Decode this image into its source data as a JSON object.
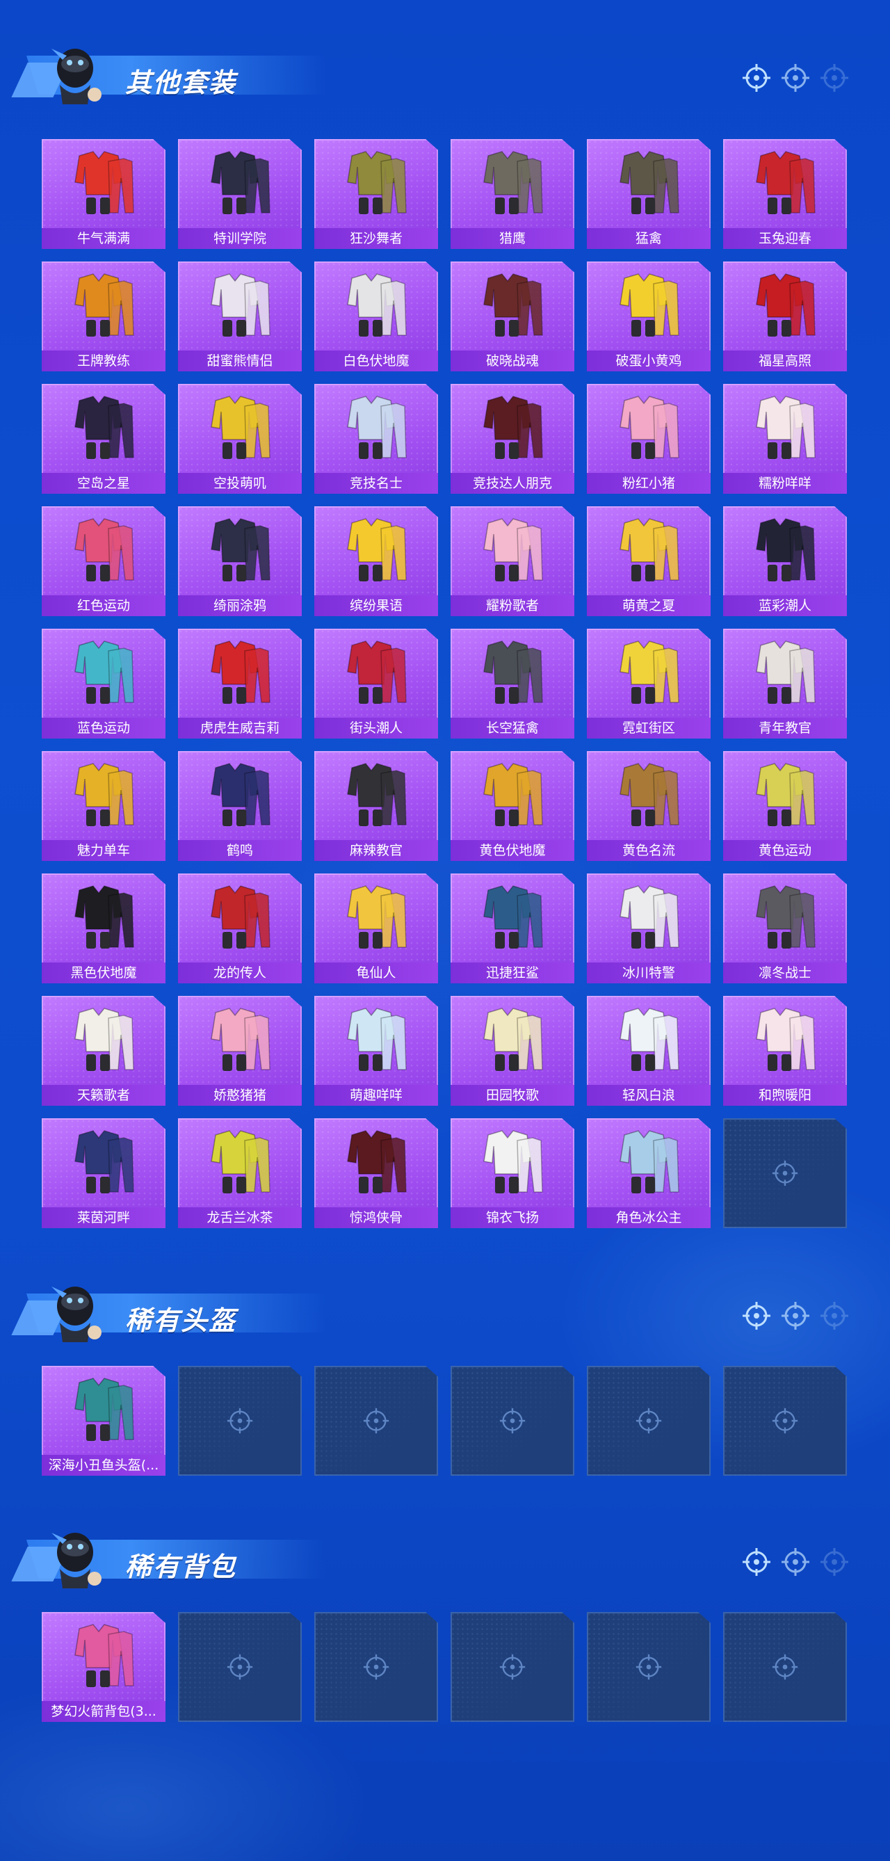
{
  "sections": [
    {
      "title": "其他套装",
      "items": [
        {
          "label": "牛气满满",
          "art": "#e0342b"
        },
        {
          "label": "特训学院",
          "art": "#2b2e45"
        },
        {
          "label": "狂沙舞者",
          "art": "#8f8a3c"
        },
        {
          "label": "猎鹰",
          "art": "#6e6a5f"
        },
        {
          "label": "猛禽",
          "art": "#5d5748"
        },
        {
          "label": "玉兔迎春",
          "art": "#c8262c"
        },
        {
          "label": "王牌教练",
          "art": "#e08a1e"
        },
        {
          "label": "甜蜜熊情侣",
          "art": "#e8e3ee"
        },
        {
          "label": "白色伏地魔",
          "art": "#e4e4e6"
        },
        {
          "label": "破晓战魂",
          "art": "#6a2a2a"
        },
        {
          "label": "破蛋小黄鸡",
          "art": "#f3cf2e"
        },
        {
          "label": "福星高照",
          "art": "#c51d22"
        },
        {
          "label": "空岛之星",
          "art": "#2a2440"
        },
        {
          "label": "空投萌叽",
          "art": "#e8c22b"
        },
        {
          "label": "竞技名士",
          "art": "#c9d7ef"
        },
        {
          "label": "竞技达人朋克",
          "art": "#5b1d22"
        },
        {
          "label": "粉红小猪",
          "art": "#f2a8c6"
        },
        {
          "label": "糯粉咩咩",
          "art": "#f5e6e9"
        },
        {
          "label": "红色运动",
          "art": "#e2527a"
        },
        {
          "label": "绮丽涂鸦",
          "art": "#2c2f47"
        },
        {
          "label": "缤纷果语",
          "art": "#f4c92d"
        },
        {
          "label": "耀粉歌者",
          "art": "#f4b8cf"
        },
        {
          "label": "萌黄之夏",
          "art": "#f2c63a"
        },
        {
          "label": "蓝彩潮人",
          "art": "#222436"
        },
        {
          "label": "蓝色运动",
          "art": "#44b6c9"
        },
        {
          "label": "虎虎生威吉莉",
          "art": "#d3262a"
        },
        {
          "label": "街头潮人",
          "art": "#c2243a"
        },
        {
          "label": "长空猛禽",
          "art": "#4a4e55"
        },
        {
          "label": "霓虹街区",
          "art": "#f0d23b"
        },
        {
          "label": "青年教官",
          "art": "#e6e1dc"
        },
        {
          "label": "魅力单车",
          "art": "#e5b126"
        },
        {
          "label": "鹤鸣",
          "art": "#2b2f6e"
        },
        {
          "label": "麻辣教官",
          "art": "#323236"
        },
        {
          "label": "黄色伏地魔",
          "art": "#e0a52a"
        },
        {
          "label": "黄色名流",
          "art": "#a97a37"
        },
        {
          "label": "黄色运动",
          "art": "#d8cf55"
        },
        {
          "label": "黑色伏地魔",
          "art": "#1e1e22"
        },
        {
          "label": "龙的传人",
          "art": "#c1262b"
        },
        {
          "label": "龟仙人",
          "art": "#f1c53d"
        },
        {
          "label": "迅捷狂鲨",
          "art": "#2c5d8a"
        },
        {
          "label": "冰川特警",
          "art": "#ececee"
        },
        {
          "label": "凛冬战士",
          "art": "#5a5a60"
        },
        {
          "label": "天籁歌者",
          "art": "#f2efe9"
        },
        {
          "label": "娇憨猪猪",
          "art": "#f3a9c4"
        },
        {
          "label": "萌趣咩咩",
          "art": "#cfe6f5"
        },
        {
          "label": "田园牧歌",
          "art": "#f0e8c0"
        },
        {
          "label": "轻风白浪",
          "art": "#eef3f8"
        },
        {
          "label": "和煦暖阳",
          "art": "#f7e3ea"
        },
        {
          "label": "莱茵河畔",
          "art": "#2c3878"
        },
        {
          "label": "龙舌兰冰茶",
          "art": "#d6d43a"
        },
        {
          "label": "惊鸿侠骨",
          "art": "#5a1a1f"
        },
        {
          "label": "锦衣飞扬",
          "art": "#f2f2f2"
        },
        {
          "label": "角色冰公主",
          "art": "#a8cde8"
        },
        {
          "label": "",
          "art": ""
        }
      ]
    },
    {
      "title": "稀有头盔",
      "items": [
        {
          "label": "深海小丑鱼头盔(...",
          "art": "#2f8e93"
        },
        {
          "label": "",
          "art": ""
        },
        {
          "label": "",
          "art": ""
        },
        {
          "label": "",
          "art": ""
        },
        {
          "label": "",
          "art": ""
        },
        {
          "label": "",
          "art": ""
        }
      ]
    },
    {
      "title": "稀有背包",
      "items": [
        {
          "label": "梦幻火箭背包(3...",
          "art": "#e25aa0"
        },
        {
          "label": "",
          "art": ""
        },
        {
          "label": "",
          "art": ""
        },
        {
          "label": "",
          "art": ""
        },
        {
          "label": "",
          "art": ""
        },
        {
          "label": "",
          "art": ""
        }
      ]
    }
  ],
  "icons": {
    "mascot": "mascot-icon",
    "reticle": "crosshair-icon",
    "empty_slot": "crosshair-icon"
  },
  "colors": {
    "background": "#0d4fd0",
    "card_purple": "#a452f3",
    "label_purple": "#8a3be6",
    "empty_slot": "#1f3f7a"
  }
}
